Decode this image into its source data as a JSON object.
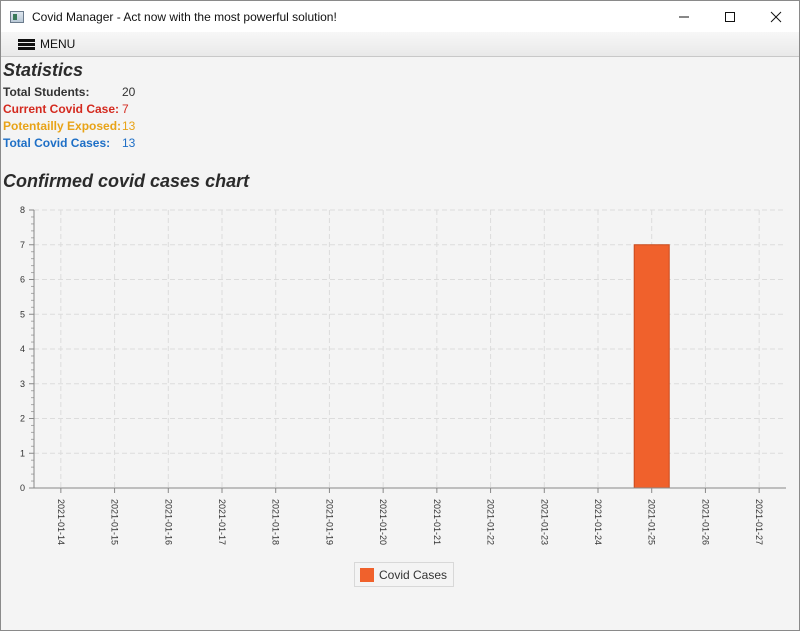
{
  "window": {
    "title": "Covid Manager - Act now with the most powerful solution!",
    "minimize_icon": "minimize-icon",
    "maximize_icon": "maximize-icon",
    "close_icon": "close-icon"
  },
  "menu": {
    "label": "MENU",
    "icon": "hamburger-icon"
  },
  "statistics": {
    "heading": "Statistics",
    "rows": [
      {
        "label": "Total Students:",
        "value": "20",
        "color": "#333333"
      },
      {
        "label": "Current Covid Case:",
        "value": "7",
        "color": "#d42a1f"
      },
      {
        "label": "Potentailly Exposed:",
        "value": "13",
        "color": "#e8a317"
      },
      {
        "label": "Total Covid Cases:",
        "value": "13",
        "color": "#1e6fc6"
      }
    ]
  },
  "chart_section": {
    "heading": "Confirmed covid cases chart"
  },
  "chart_data": {
    "type": "bar",
    "categories": [
      "2021-01-14",
      "2021-01-15",
      "2021-01-16",
      "2021-01-17",
      "2021-01-18",
      "2021-01-19",
      "2021-01-20",
      "2021-01-21",
      "2021-01-22",
      "2021-01-23",
      "2021-01-24",
      "2021-01-25",
      "2021-01-26",
      "2021-01-27"
    ],
    "series": [
      {
        "name": "Covid Cases",
        "values": [
          0,
          0,
          0,
          0,
          0,
          0,
          0,
          0,
          0,
          0,
          0,
          7,
          0,
          0
        ],
        "color": "#f0612c"
      }
    ],
    "ylim": [
      0,
      8
    ],
    "yticks": [
      0,
      1,
      2,
      3,
      4,
      5,
      6,
      7,
      8
    ],
    "grid": true,
    "legend": "bottom-center",
    "xlabel": "",
    "ylabel": ""
  }
}
